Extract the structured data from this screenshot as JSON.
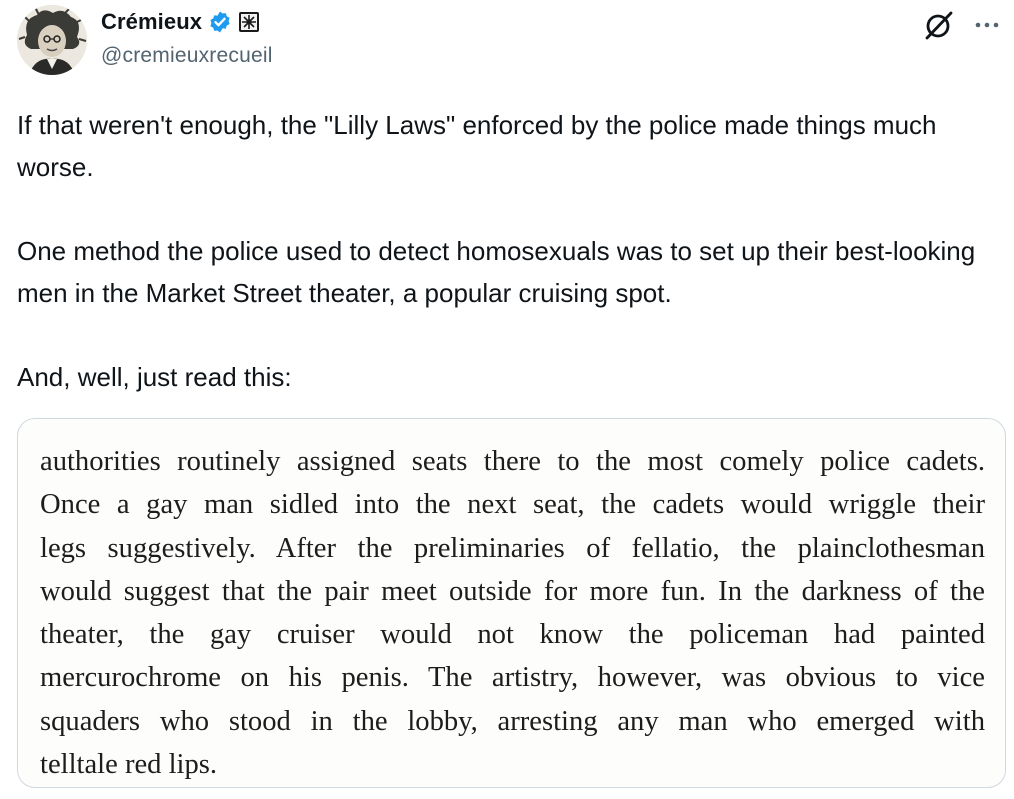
{
  "author": {
    "display_name": "Crémieux",
    "handle": "@cremieuxrecueil",
    "avatar_icon": "avatar-portrait",
    "verified_icon": "verified-badge-icon",
    "verified_color": "#1d9bf0",
    "affiliation_icon": "affiliation-badge-icon"
  },
  "actions": {
    "grok_icon": "grok-icon",
    "more_icon": "more-options-icon"
  },
  "tweet": {
    "paragraphs": [
      "If that weren't enough, the \"Lilly Laws\" enforced by the police made things much worse.",
      "One method the police used to detect homosexuals was to set up their best-looking men in the Market Street theater, a popular cruising spot.",
      "And, well, just read this:"
    ]
  },
  "media": {
    "lines": [
      "authorities routinely assigned seats there to the most comely police cadets.",
      "Once a gay man sidled into the next seat, the cadets would wriggle their",
      "legs suggestively. After the preliminaries of fellatio, the plainclothesman",
      "would suggest that the pair meet outside for more fun. In the darkness of the",
      "theater, the gay cruiser would not know the policeman had painted",
      "mercurochrome on his penis. The artistry, however, was obvious to vice",
      "squaders who stood in the lobby, arresting any man who emerged with",
      "telltale red lips."
    ]
  },
  "colors": {
    "text_primary": "#0f1419",
    "text_secondary": "#536471",
    "card_border": "#cfd9de"
  }
}
